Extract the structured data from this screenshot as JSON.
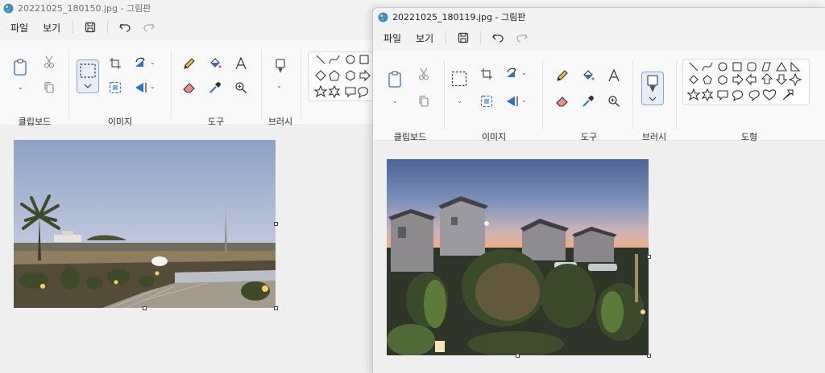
{
  "back_window": {
    "title": "20221025_180150.jpg - 그림판",
    "menu": {
      "file": "파일",
      "view": "보기"
    },
    "groups": {
      "clipboard": "클립보드",
      "image": "이미지",
      "tools": "도구",
      "brush": "브러시"
    }
  },
  "front_window": {
    "title": "20221025_180119.jpg - 그림판",
    "menu": {
      "file": "파일",
      "view": "보기"
    },
    "groups": {
      "clipboard": "클립보드",
      "image": "이미지",
      "tools": "도구",
      "brush": "브러시",
      "shapes": "도형"
    }
  },
  "icons": {
    "app": "paint-app-icon",
    "save": "save-icon",
    "undo": "undo-icon",
    "redo": "redo-icon",
    "paste": "paste-icon",
    "cut": "cut-icon",
    "copy": "copy-icon",
    "select": "selection-icon",
    "crop": "crop-icon",
    "resize": "resize-icon",
    "rotate": "rotate-icon",
    "flip": "flip-icon",
    "pencil": "pencil-icon",
    "fill": "fill-bucket-icon",
    "text": "text-icon",
    "eraser": "eraser-icon",
    "picker": "color-picker-icon",
    "magnifier": "magnifier-icon",
    "brush": "brush-icon"
  },
  "colors": {
    "accent": "#2f6fd1",
    "selected_border": "#8aa6d6",
    "selected_fill": "#e7eef9"
  }
}
